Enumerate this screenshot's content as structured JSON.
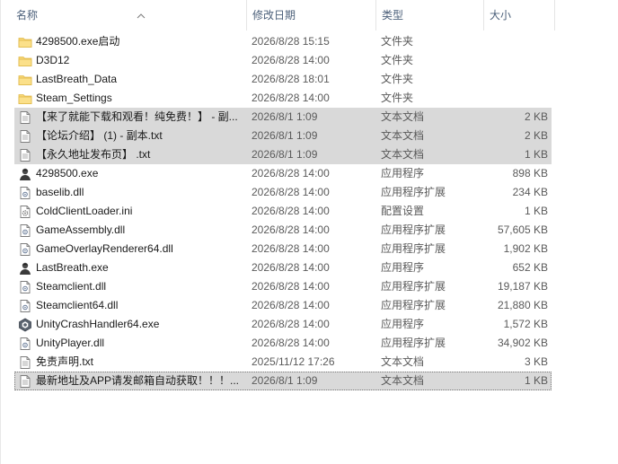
{
  "header": {
    "name": "名称",
    "date": "修改日期",
    "type": "类型",
    "size": "大小"
  },
  "files": [
    {
      "name": "4298500.exe启动",
      "date": "2026/8/28 15:15",
      "type": "文件夹",
      "size": "",
      "icon": "folder-icon",
      "selected": false
    },
    {
      "name": "D3D12",
      "date": "2026/8/28 14:00",
      "type": "文件夹",
      "size": "",
      "icon": "folder-icon",
      "selected": false
    },
    {
      "name": "LastBreath_Data",
      "date": "2026/8/28 18:01",
      "type": "文件夹",
      "size": "",
      "icon": "folder-icon",
      "selected": false
    },
    {
      "name": "Steam_Settings",
      "date": "2026/8/28 14:00",
      "type": "文件夹",
      "size": "",
      "icon": "folder-icon",
      "selected": false
    },
    {
      "name": "【来了就能下载和观看！纯免费！】 - 副...",
      "date": "2026/8/1 1:09",
      "type": "文本文档",
      "size": "2 KB",
      "icon": "text-file-icon",
      "selected": true
    },
    {
      "name": "【论坛介绍】 (1) - 副本.txt",
      "date": "2026/8/1 1:09",
      "type": "文本文档",
      "size": "2 KB",
      "icon": "text-file-icon",
      "selected": true
    },
    {
      "name": "【永久地址发布页】 .txt",
      "date": "2026/8/1 1:09",
      "type": "文本文档",
      "size": "1 KB",
      "icon": "text-file-icon",
      "selected": true
    },
    {
      "name": "4298500.exe",
      "date": "2026/8/28 14:00",
      "type": "应用程序",
      "size": "898 KB",
      "icon": "user-app-icon",
      "selected": false
    },
    {
      "name": "baselib.dll",
      "date": "2026/8/28 14:00",
      "type": "应用程序扩展",
      "size": "234 KB",
      "icon": "dll-file-icon",
      "selected": false
    },
    {
      "name": "ColdClientLoader.ini",
      "date": "2026/8/28 14:00",
      "type": "配置设置",
      "size": "1 KB",
      "icon": "ini-file-icon",
      "selected": false
    },
    {
      "name": "GameAssembly.dll",
      "date": "2026/8/28 14:00",
      "type": "应用程序扩展",
      "size": "57,605 KB",
      "icon": "dll-file-icon",
      "selected": false
    },
    {
      "name": "GameOverlayRenderer64.dll",
      "date": "2026/8/28 14:00",
      "type": "应用程序扩展",
      "size": "1,902 KB",
      "icon": "dll-file-icon",
      "selected": false
    },
    {
      "name": "LastBreath.exe",
      "date": "2026/8/28 14:00",
      "type": "应用程序",
      "size": "652 KB",
      "icon": "user-app-icon",
      "selected": false
    },
    {
      "name": "Steamclient.dll",
      "date": "2026/8/28 14:00",
      "type": "应用程序扩展",
      "size": "19,187 KB",
      "icon": "dll-file-icon",
      "selected": false
    },
    {
      "name": "Steamclient64.dll",
      "date": "2026/8/28 14:00",
      "type": "应用程序扩展",
      "size": "21,880 KB",
      "icon": "dll-file-icon",
      "selected": false
    },
    {
      "name": "UnityCrashHandler64.exe",
      "date": "2026/8/28 14:00",
      "type": "应用程序",
      "size": "1,572 KB",
      "icon": "unity-icon",
      "selected": false
    },
    {
      "name": "UnityPlayer.dll",
      "date": "2026/8/28 14:00",
      "type": "应用程序扩展",
      "size": "34,902 KB",
      "icon": "dll-file-icon",
      "selected": false
    },
    {
      "name": "免责声明.txt",
      "date": "2025/11/12 17:26",
      "type": "文本文档",
      "size": "3 KB",
      "icon": "text-file-icon",
      "selected": false
    },
    {
      "name": "最新地址及APP请发邮箱自动获取！！！...",
      "date": "2026/8/1 1:09",
      "type": "文本文档",
      "size": "1 KB",
      "icon": "text-file-icon",
      "selected": true
    }
  ],
  "colors": {
    "header_text": "#4c607a",
    "selection": "#d9d9d9",
    "folder": "#f8d775"
  }
}
